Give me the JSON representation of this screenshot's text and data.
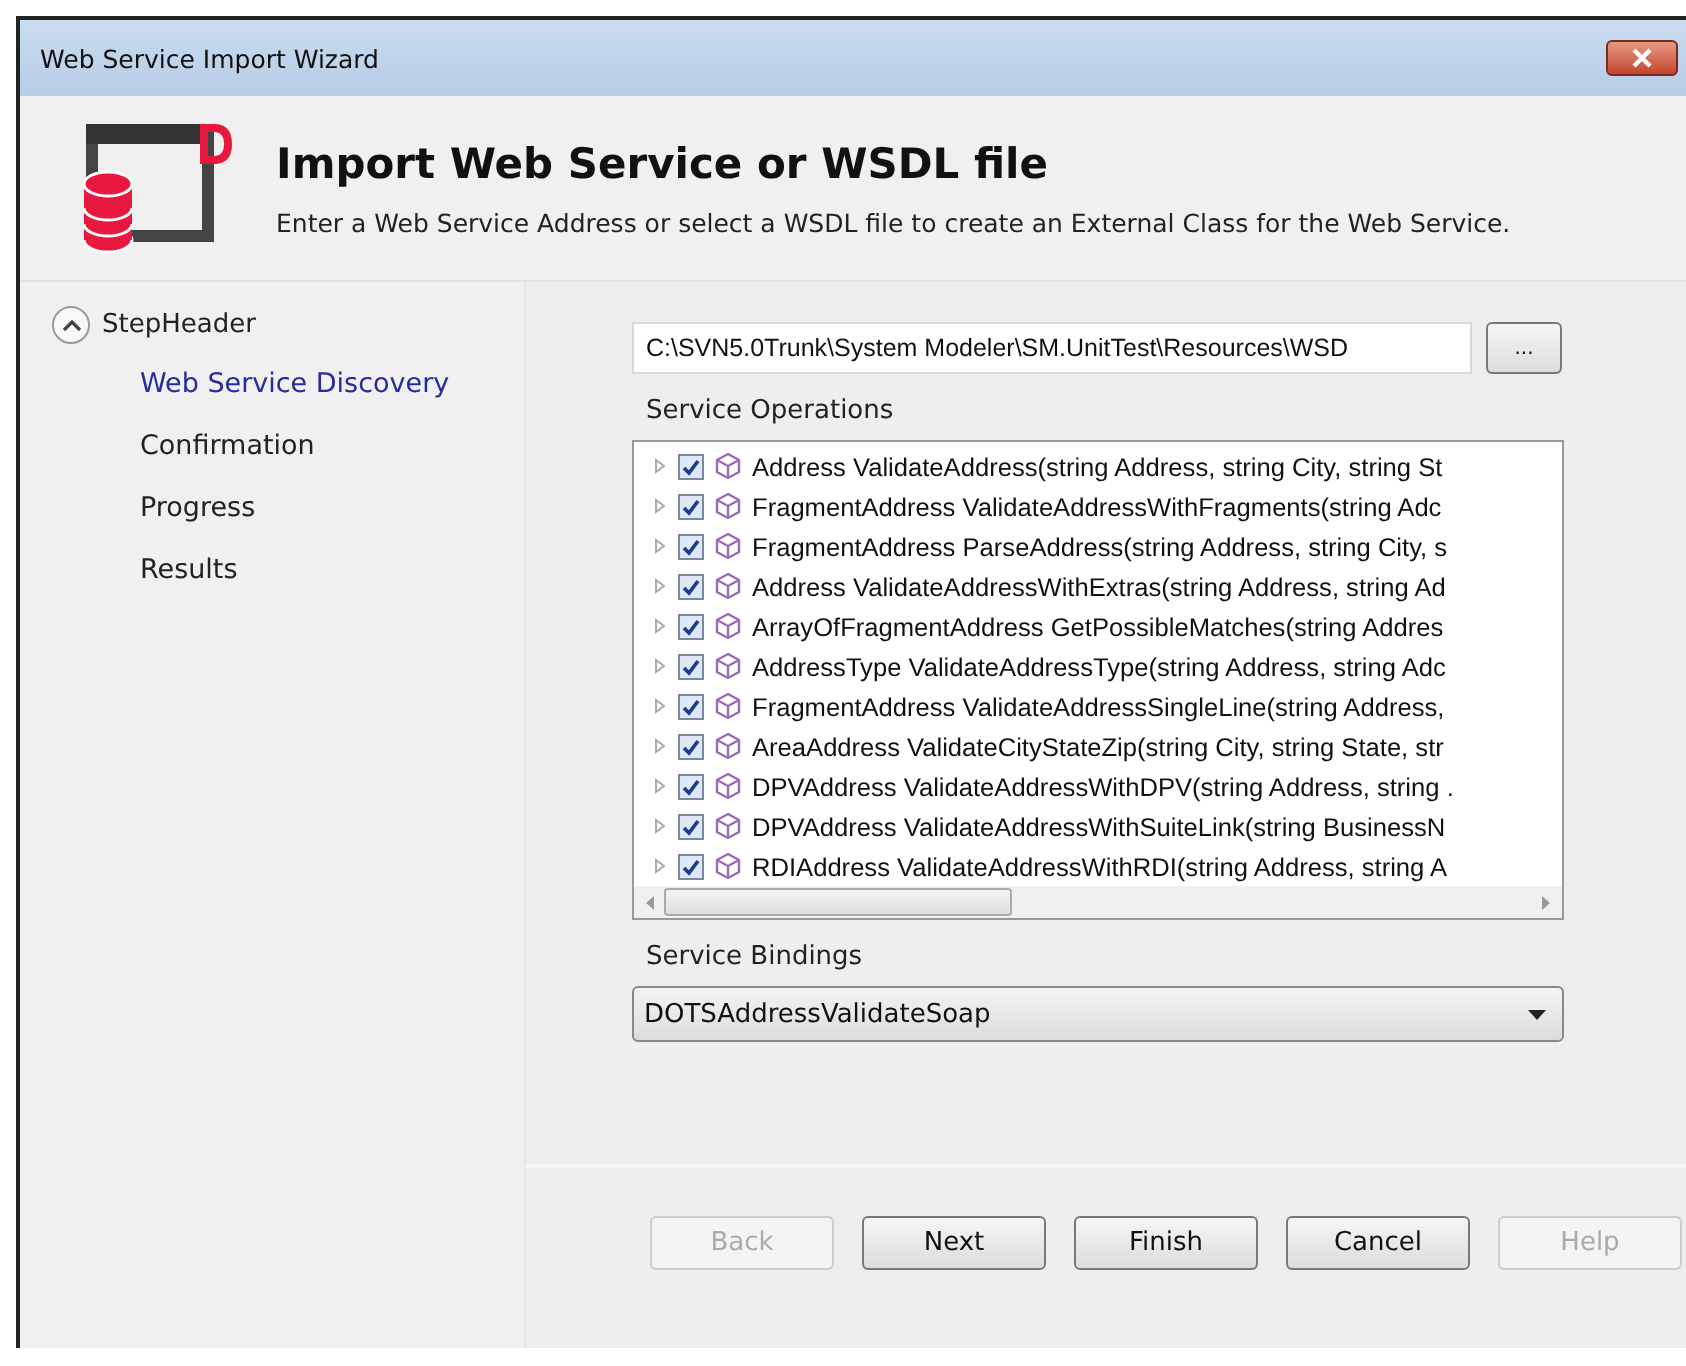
{
  "window": {
    "title": "Web Service Import Wizard"
  },
  "header": {
    "title": "Import Web Service or WSDL file",
    "description": "Enter a Web Service Address or select a WSDL file to create an External Class for the Web Service."
  },
  "sidebar": {
    "group": {
      "label": "StepHeader",
      "expanded": true
    },
    "steps": [
      {
        "label": "Web Service Discovery",
        "selected": true
      },
      {
        "label": "Confirmation",
        "selected": false
      },
      {
        "label": "Progress",
        "selected": false
      },
      {
        "label": "Results",
        "selected": false
      }
    ]
  },
  "address_field": {
    "value": "C:\\SVN5.0Trunk\\System Modeler\\SM.UnitTest\\Resources\\WSD",
    "browse_button": "..."
  },
  "operations": {
    "label": "Service Operations",
    "items": [
      {
        "text": "Address ValidateAddress(string Address, string City, string St",
        "checked": true
      },
      {
        "text": "FragmentAddress ValidateAddressWithFragments(string Adc",
        "checked": true
      },
      {
        "text": "FragmentAddress ParseAddress(string Address, string City, s",
        "checked": true
      },
      {
        "text": "Address ValidateAddressWithExtras(string Address, string Ad",
        "checked": true
      },
      {
        "text": "ArrayOfFragmentAddress GetPossibleMatches(string Addres",
        "checked": true
      },
      {
        "text": "AddressType ValidateAddressType(string Address, string Adc",
        "checked": true
      },
      {
        "text": "FragmentAddress ValidateAddressSingleLine(string Address,",
        "checked": true
      },
      {
        "text": "AreaAddress ValidateCityStateZip(string City, string State, str",
        "checked": true
      },
      {
        "text": "DPVAddress ValidateAddressWithDPV(string Address, string .",
        "checked": true
      },
      {
        "text": "DPVAddress ValidateAddressWithSuiteLink(string BusinessN",
        "checked": true
      },
      {
        "text": "RDIAddress ValidateAddressWithRDI(string Address, string A",
        "checked": true
      }
    ]
  },
  "bindings": {
    "label": "Service Bindings",
    "value": "DOTSAddressValidateSoap"
  },
  "buttons": [
    {
      "label": "Back",
      "disabled": true
    },
    {
      "label": "Next",
      "disabled": false
    },
    {
      "label": "Finish",
      "disabled": false
    },
    {
      "label": "Cancel",
      "disabled": false
    },
    {
      "label": "Help",
      "disabled": true
    }
  ]
}
